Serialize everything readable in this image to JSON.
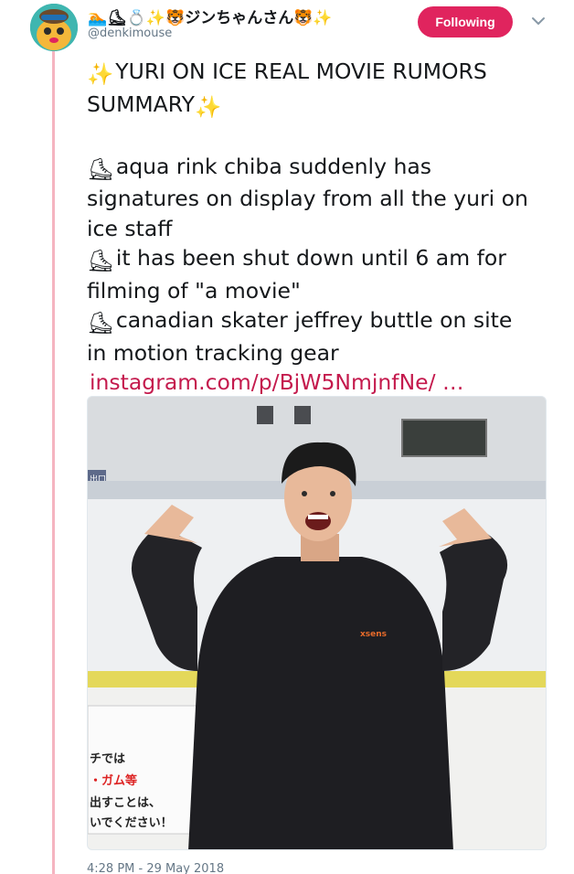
{
  "user": {
    "display_name": "🏊⛸💍✨🐯ジンちゃんさん🐯✨",
    "handle": "@denkimouse"
  },
  "follow_button": {
    "label": "Following"
  },
  "colors": {
    "accent": "#e0245e",
    "link": "#c41a4d",
    "thread_line": "#f5b4c0",
    "secondary_text": "#657786"
  },
  "tweet": {
    "title_line1": "YURI ON ICE REAL MOVIE RUMORS",
    "title_line2": "SUMMARY",
    "p1_line1": "aqua rink chiba suddenly has",
    "p1_line2": "signatures on display from all the yuri on",
    "p1_line3": "ice staff",
    "p2_line1": "it has been shut down until 6 am for",
    "p2_line2": "filming of \"a movie\"",
    "p3_line1": "canadian skater jeffrey buttle on site",
    "p3_line2": "in motion tracking gear",
    "link": "instagram.com/p/BjW5NmjnfNe/ …",
    "sparkle_emoji": "✨",
    "skate_emoji": "⛸"
  },
  "media": {
    "shirt_text": "xsens",
    "sign_line1": "チでは",
    "sign_line2": "・ガム等",
    "sign_line3": "出すことは、",
    "sign_line4": "いでください！",
    "wall_sign": "出口"
  },
  "timestamp": "4:28 PM - 29 May 2018"
}
